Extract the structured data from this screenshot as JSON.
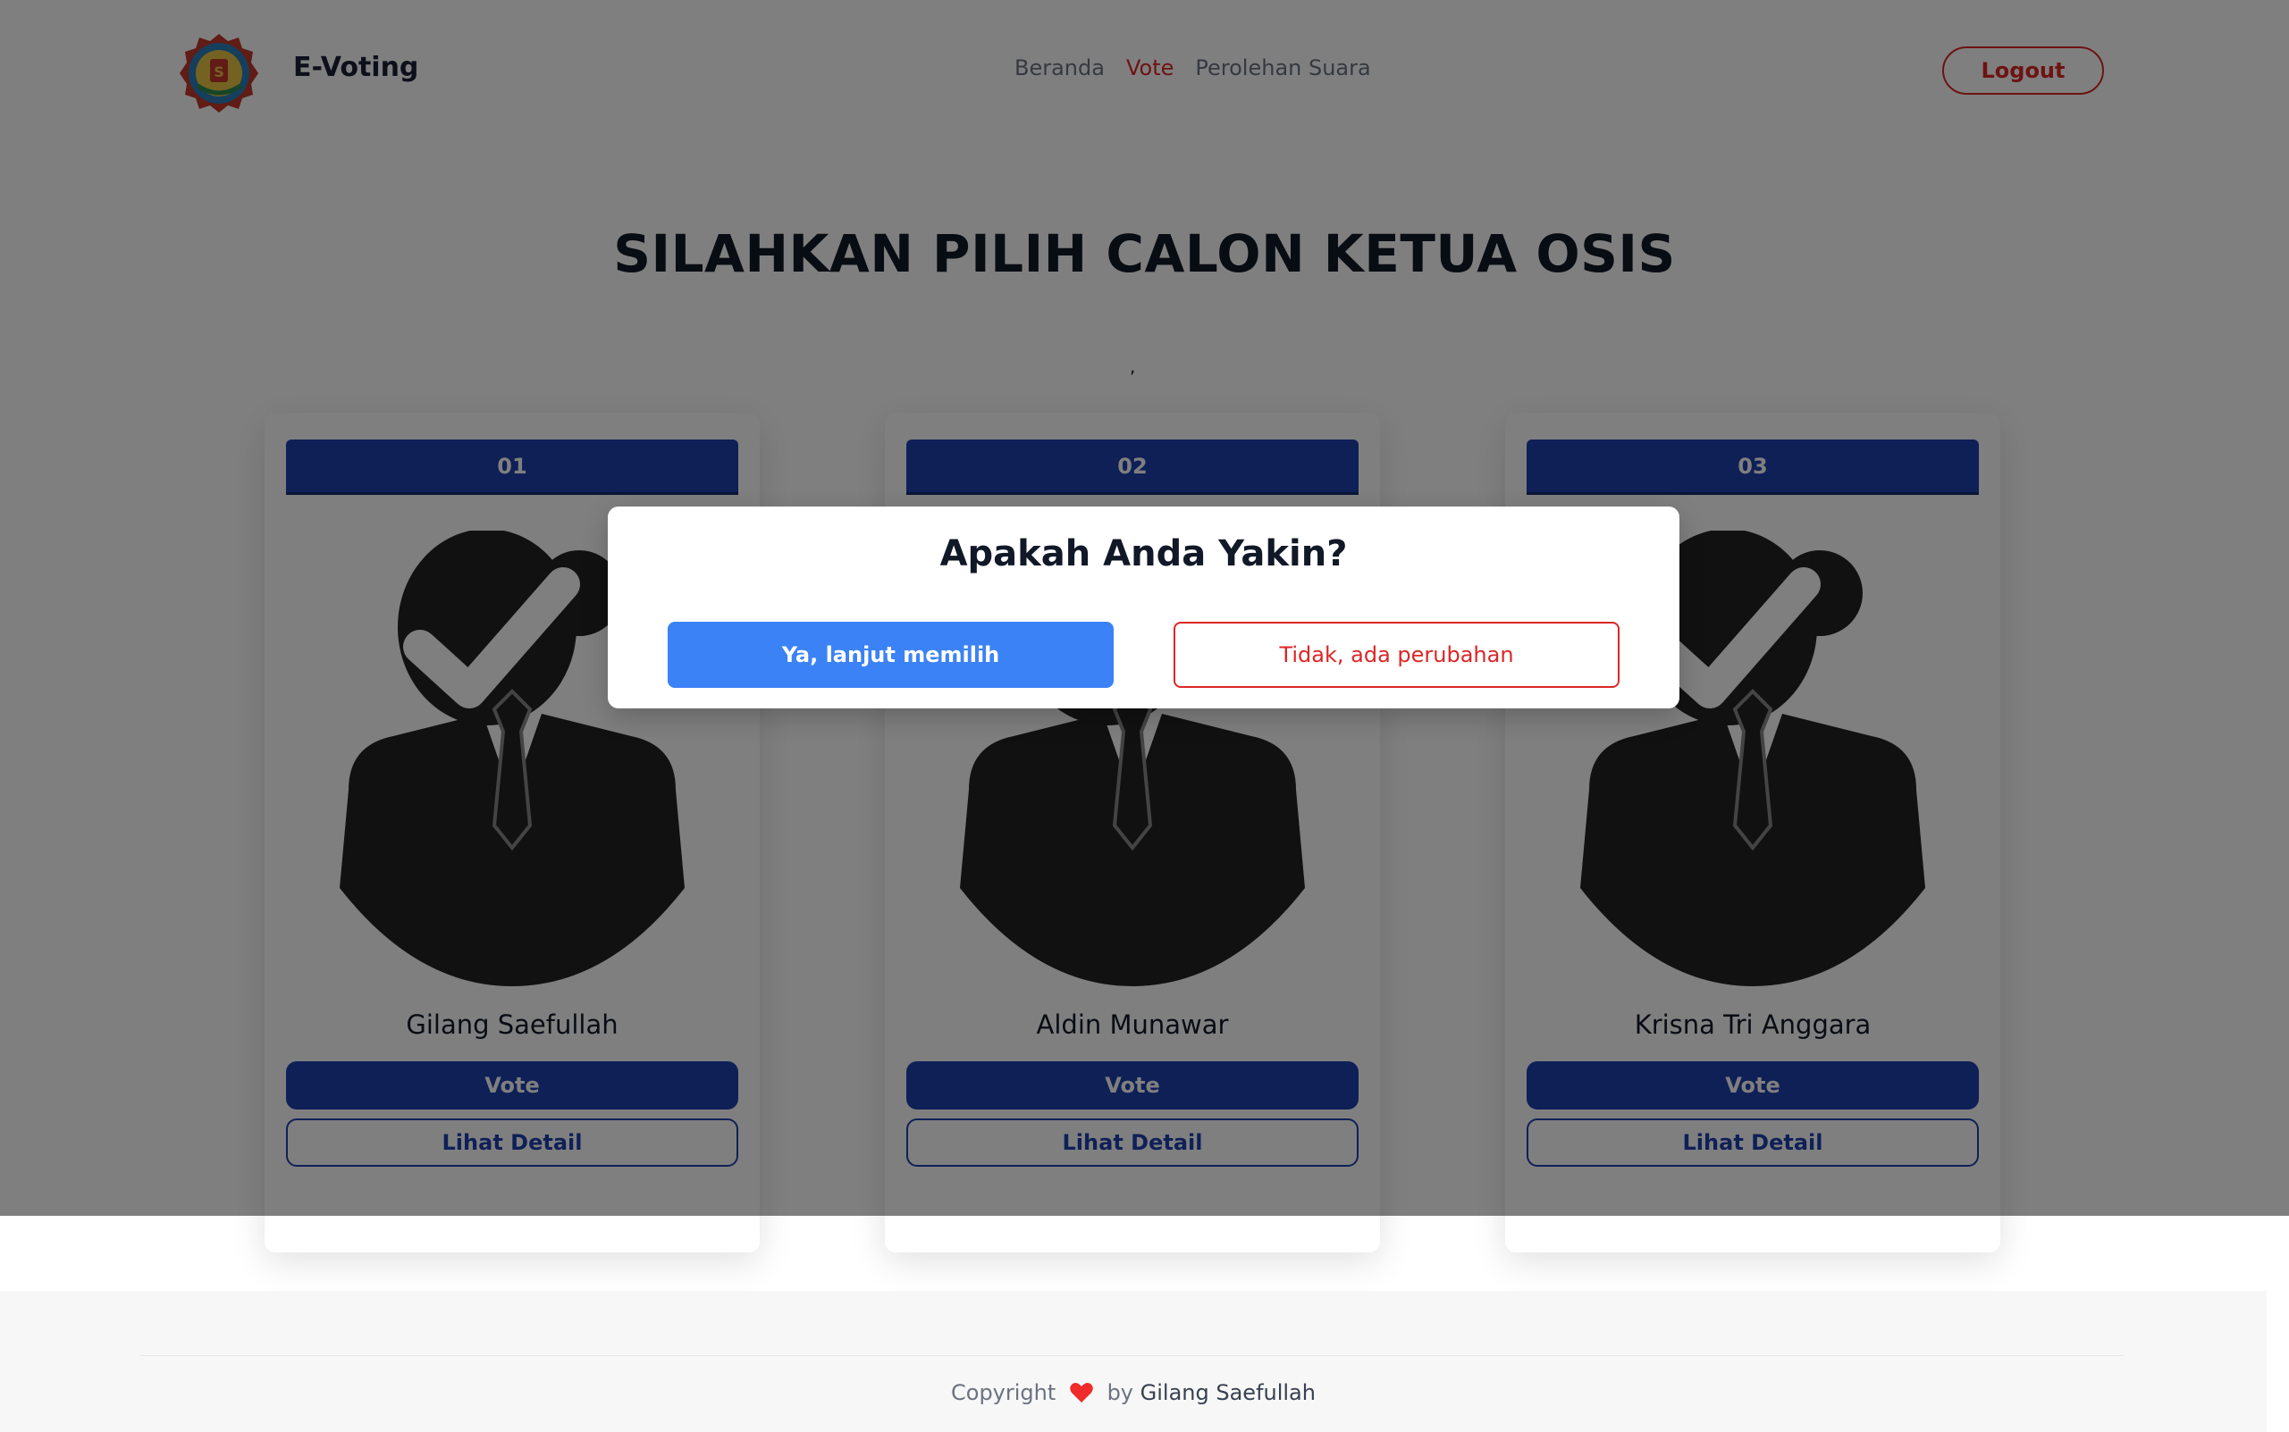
{
  "header": {
    "brand": "E-Voting",
    "nav": [
      "Beranda",
      "Vote",
      "Perolehan Suara"
    ],
    "active_nav": "Vote",
    "logout": "Logout"
  },
  "main": {
    "title": "SILAHKAN PILIH CALON KETUA OSIS",
    "subtitle_mark": ","
  },
  "candidates": [
    {
      "number": "01",
      "name": "Gilang Saefullah",
      "vote_label": "Vote",
      "detail_label": "Lihat Detail"
    },
    {
      "number": "02",
      "name": "Aldin Munawar",
      "vote_label": "Vote",
      "detail_label": "Lihat Detail"
    },
    {
      "number": "03",
      "name": "Krisna Tri Anggara",
      "vote_label": "Vote",
      "detail_label": "Lihat Detail"
    }
  ],
  "modal": {
    "title": "Apakah Anda Yakin?",
    "confirm": "Ya, lanjut memilih",
    "cancel": "Tidak, ada perubahan"
  },
  "footer": {
    "copyright": "Copyright",
    "by": "by",
    "author": "Gilang Saefullah"
  },
  "colors": {
    "primary": "#1e40af",
    "danger": "#dc2626",
    "confirm": "#3b82f6",
    "overlay": "rgba(0,0,0,0.5)"
  }
}
